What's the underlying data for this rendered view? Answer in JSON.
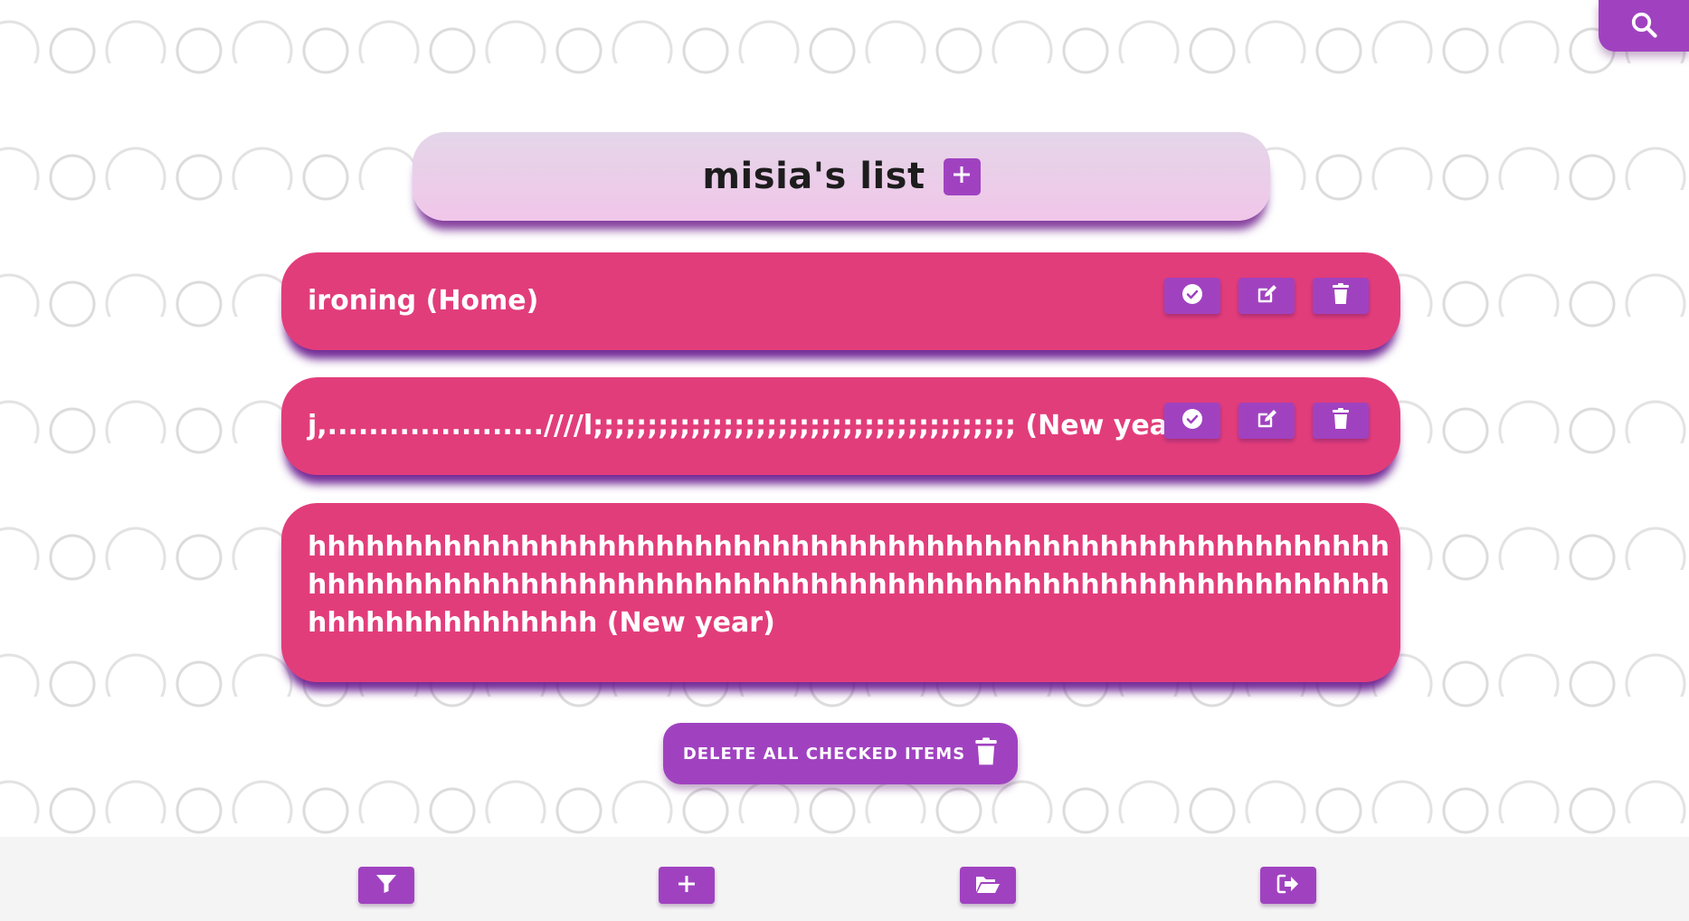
{
  "list": {
    "title": "misia's list"
  },
  "items": [
    {
      "text": "ironing (Home)"
    },
    {
      "text": "j,.....................////l;;;;;;;;;;;;;;;;;;;;;;;;;;;;;;;;;;;;;;; (New year)"
    },
    {
      "text": "hhhhhhhhhhhhhhhhhhhhhhhhhhhhhhhhhhhhhhhhhhhhhhhhhhhhhhhhhhhhhhhhhhhhhhhhhhhhhhhhhhhhhhhhhhhhhhhhhhhhhhhhhhhhhhhhhhhhhhhhhhhhhhh (New year)"
    }
  ],
  "actions": {
    "delete_all_label": "DELETE ALL CHECKED ITEMS"
  },
  "icons": {
    "search": "search-icon",
    "add": "plus-icon",
    "check": "check-circle-icon",
    "edit": "edit-icon",
    "delete": "trash-icon",
    "filter": "filter-icon",
    "folder": "folder-open-icon",
    "logout": "logout-icon"
  },
  "colors": {
    "accent": "#a042c0",
    "item_bg": "#e23d7b",
    "header_bg": "#ecd0ea",
    "bottom_bar": "#f4f4f4"
  }
}
